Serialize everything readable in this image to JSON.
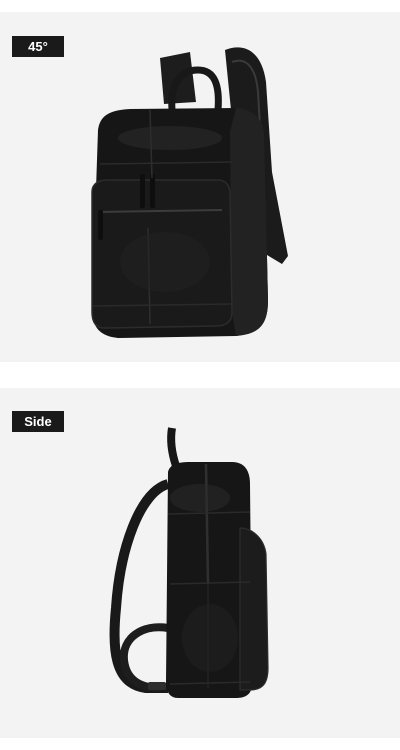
{
  "panels": [
    {
      "label": "45°"
    },
    {
      "label": "Side"
    }
  ],
  "colors": {
    "background": "#f3f3f3",
    "label_bg": "#1a1a1a",
    "label_text": "#ffffff",
    "leather": "#161616"
  }
}
